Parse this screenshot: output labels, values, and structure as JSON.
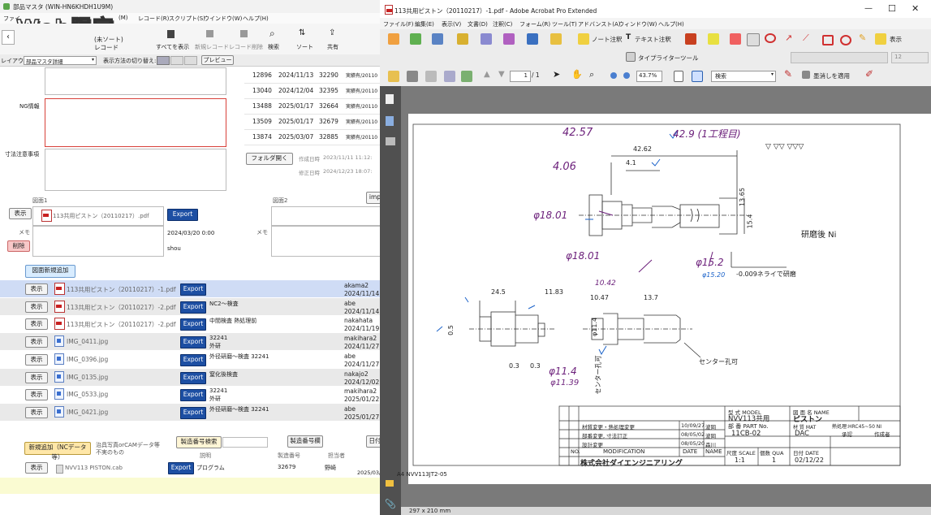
{
  "left_window": {
    "title": "部品マスタ (WIN-HN6KHDH1U9M)",
    "watermark": "Web限定",
    "menu": [
      "ファイ",
      "(M)",
      "レコード(R)",
      "スクリプト(S)",
      "ウインドウ(W)",
      "ヘルプ(H)"
    ],
    "toolbar": {
      "record_label": "レコード",
      "record_count": "(未ソート)",
      "show_all": "すべてを表示",
      "new_record": "新規レコード",
      "delete_record": "レコード削除",
      "search": "検索",
      "sort": "ソート",
      "share": "共有"
    },
    "layout_bar": {
      "layout_label": "レイアウト:",
      "layout_value": "部品マスタ詳細",
      "view_label": "表示方法の切り替え:",
      "preview": "プレビュー"
    },
    "labels": {
      "ng": "NG情報",
      "dimension": "寸法注意事項",
      "fig1": "図面1",
      "fig2": "図面2",
      "memo": "メモ",
      "memo2": "メモ"
    },
    "history_rows": [
      {
        "id": "12896",
        "date": "2024/11/13",
        "code": "32290",
        "note": "実績有/20110"
      },
      {
        "id": "13040",
        "date": "2024/12/04",
        "code": "32395",
        "note": "実績有/20110"
      },
      {
        "id": "13488",
        "date": "2025/01/17",
        "code": "32664",
        "note": "実績有/20110"
      },
      {
        "id": "13509",
        "date": "2025/01/17",
        "code": "32679",
        "note": "実績有/20110"
      },
      {
        "id": "13874",
        "date": "2025/03/07",
        "code": "32885",
        "note": "実績有/20110"
      }
    ],
    "folder_open": "フォルダ開く",
    "created_label": "作成日時",
    "created_value": "2023/11/11 11:12:",
    "modified_label": "修正日時",
    "modified_value": "2024/12/23 18:07:",
    "fig1": {
      "show": "表示",
      "file": "113共用ピストン（20110217）.pdf",
      "export": "Export",
      "date": "2024/03/20 0:00",
      "user": "shou",
      "delete": "削除"
    },
    "fig2_button": "imp",
    "add_drawing": "図面新規追加",
    "files": [
      {
        "show": "表示",
        "name": "113共用ピストン（20110217）-1.pdf",
        "type": "pdf",
        "export": "Export",
        "desc1": "",
        "desc2": "",
        "user": "akama2",
        "date": "2024/11/14"
      },
      {
        "show": "表示",
        "name": "113共用ピストン（20110217）-2.pdf",
        "type": "pdf",
        "export": "Export",
        "desc1": "NC2～検査",
        "desc2": "",
        "user": "abe",
        "date": "2024/11/14"
      },
      {
        "show": "表示",
        "name": "113共用ピストン（20110217）-2.pdf",
        "type": "pdf",
        "export": "Export",
        "desc1": "中間検査 熱処理前",
        "desc2": "",
        "user": "nakahata",
        "date": "2024/11/19"
      },
      {
        "show": "表示",
        "name": "IMG_0411.jpg",
        "type": "img",
        "export": "Export",
        "desc1": "32241",
        "desc2": "外研",
        "user": "makihara2",
        "date": "2024/11/27"
      },
      {
        "show": "表示",
        "name": "IMG_0396.jpg",
        "type": "img",
        "export": "Export",
        "desc1": "外径研磨～検査 32241",
        "desc2": "",
        "user": "abe",
        "date": "2024/11/27"
      },
      {
        "show": "表示",
        "name": "IMG_0135.jpg",
        "type": "img",
        "export": "Export",
        "desc1": "窒化後検査",
        "desc2": "",
        "user": "nakajo2",
        "date": "2024/12/02"
      },
      {
        "show": "表示",
        "name": "IMG_0533.jpg",
        "type": "img",
        "export": "Export",
        "desc1": "32241",
        "desc2": "外研",
        "user": "makihara2",
        "date": "2025/01/22"
      },
      {
        "show": "表示",
        "name": "IMG_0421.jpg",
        "type": "img",
        "export": "Export",
        "desc1": "外径研磨～検査 32241",
        "desc2": "",
        "user": "abe",
        "date": "2025/01/27"
      }
    ],
    "nc_section": {
      "new_nc": "新規追加（NCデータ等）",
      "note1": "治具写真orCAMデータ等",
      "note2": "不実のもの",
      "search_btn": "製造番号検索",
      "search_btn2": "製造番号欄",
      "day_btn": "日付",
      "col_desc": "説明",
      "col_no": "製造番号",
      "col_person": "担当者",
      "row": {
        "show": "表示",
        "file": "NVV113 PISTON.cab",
        "export": "Export",
        "desc": "プログラム",
        "no": "32679",
        "person": "野崎",
        "date": "2025/03/"
      }
    }
  },
  "right_window": {
    "title": "113共用ピストン（20110217）-1.pdf - Adobe Acrobat Pro Extended",
    "menu": [
      "ファイル(F)",
      "編集(E)",
      "表示(V)",
      "文書(D)",
      "注釈(C)",
      "フォーム(R)",
      "ツール(T)",
      "アドバンスト(A)",
      "ウィンドウ(W)",
      "ヘルプ(H)"
    ],
    "toolbar1": {
      "note_comment": "ノート注釈",
      "text_comment": "テキスト注釈",
      "display": "表示"
    },
    "toolbar2": {
      "typewriter": "タイプライターツール",
      "font_size": "12"
    },
    "toolbar3": {
      "page": "1",
      "page_total": "/ 1",
      "zoom": "43.7%",
      "search": "検索",
      "apply": "墨消しを適用"
    },
    "status": "297 x 210 mm",
    "drawing": {
      "dims": [
        "42.57",
        "42.9 (1工程目)",
        "42.62",
        "4.1",
        "4.06",
        "13.65",
        "15.4",
        "φ18.01",
        "φ18.01",
        "φ15.2",
        "φ15.20",
        "-0.009ネライで研磨",
        "研磨後 Ni",
        "24.5",
        "11.83",
        "10.42",
        "10.47",
        "13.7",
        "φ11.4",
        "φ11.39",
        "0.5",
        "0.3",
        "0.3",
        "センター孔可",
        "センター孔可",
        "φ11.4",
        "▽  ▽▽  ▽▽▽"
      ],
      "title_block": {
        "model_label": "型 式 MODEL",
        "model_value": "NVV113共用",
        "name_label": "図 面 名 NAME",
        "name_value": "ピストン",
        "part_label": "部 番 PART No.",
        "part_value": "11CB-02",
        "mat_label": "材 質 MAT",
        "mat_value": "DAC",
        "heat": "熱処理:HRC45~50 NI",
        "approve": "承認",
        "author": "作成者",
        "scale_label": "尺度 SCALE",
        "scale_value": "1:1",
        "qty_label": "個数 QUA",
        "qty_value": "1",
        "date_label": "日付 DATE",
        "date_value": "02/12/22",
        "company": "株式会社ダイエンジニアリング",
        "no_label": "NO.",
        "mod_label": "MODIFICATION",
        "date_col": "DATE",
        "name_col": "NAME",
        "revisions": [
          {
            "text": "材質変更・熱処理変更",
            "date": "10/09/27",
            "name": "波岡"
          },
          {
            "text": "部番変更, 寸法訂正",
            "date": "08/05/02",
            "name": "波岡"
          },
          {
            "text": "設計変更",
            "date": "08/05/20",
            "name": "森川"
          }
        ]
      },
      "footer": "A4  NVV113JT2-05"
    }
  }
}
